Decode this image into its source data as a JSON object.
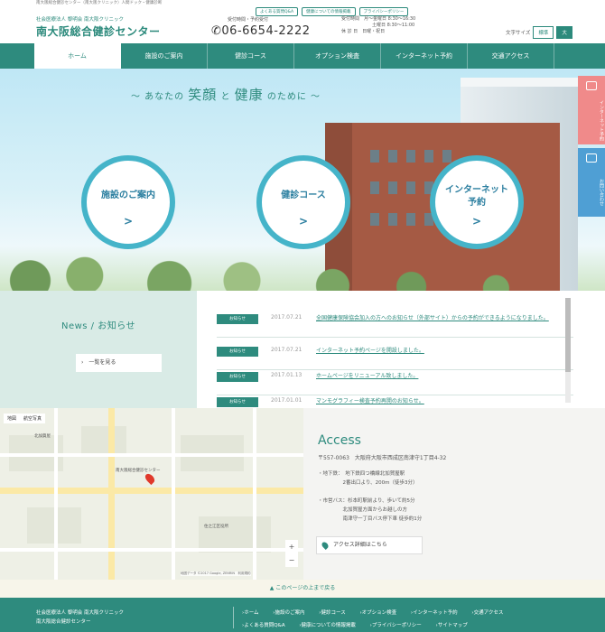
{
  "topstrip": {
    "text": "南大阪総合健診センター（南大阪クリニック）人間ドック・健康診断"
  },
  "header": {
    "corp_sub": "社会医療法人 黎明会 南大阪クリニック",
    "corp_title": "南大阪総合健診センター",
    "tel": "06-6654-2222",
    "hours_label": "受付時間・予約受付",
    "hours": [
      "受付時間　月～金曜日 8:30～16:30",
      "土曜日 8:30～11:00",
      "休 診 日　日曜・祝日"
    ],
    "toplinks": [
      "よくある質問Q&A",
      "健康についての情報掲載",
      "プライバシーポリシー"
    ],
    "font_size_label": "文字サイズ",
    "font_std": "標準",
    "font_big": "大"
  },
  "nav": {
    "items": [
      "ホーム",
      "施設のご案内",
      "健診コース",
      "オプション検査",
      "インターネット予約",
      "交通アクセス"
    ]
  },
  "hero": {
    "title_pre": "〜 あなたの ",
    "title_em1": "笑顔",
    "title_mid": " と ",
    "title_em2": "健康",
    "title_post": " のために 〜",
    "circles": [
      {
        "label": "施設のご案内",
        "chev": ">"
      },
      {
        "label": "健診コース",
        "chev": ">"
      },
      {
        "label": "インターネット予約",
        "chev": ">"
      }
    ],
    "sidetab_1": "インターネット予約",
    "sidetab_2": "お問い合わせ"
  },
  "news": {
    "title": "News / お知らせ",
    "button": "一覧を見る",
    "items": [
      {
        "badge": "お知らせ",
        "date": "2017.07.21",
        "text": "全国健康保険協会加入の方へのお知らせ（外部サイト）からの予約ができるようになりました。"
      },
      {
        "badge": "お知らせ",
        "date": "2017.07.21",
        "text": "インターネット予約ページを開設しました。"
      },
      {
        "badge": "お知らせ",
        "date": "2017.01.13",
        "text": "ホームページをリニューアル致しました。"
      },
      {
        "badge": "お知らせ",
        "date": "2017.01.01",
        "text": "マンモグラフィー検査予約再開のお知らせ。"
      }
    ]
  },
  "map": {
    "type_map": "地図",
    "type_sat": "航空写真",
    "labels": [
      "北加賀屋",
      "南大阪総合健診センター",
      "住之江区役所"
    ],
    "copy": "地図データ ©2017 Google, ZENRIN　利用規約",
    "zoom_in": "+",
    "zoom_out": "−"
  },
  "access": {
    "title": "Access",
    "addr": "〒557-0063　大阪府大阪市西成区南津守1丁目4-32",
    "lines": [
      "・地下鉄：　地下鉄四つ橋線北加賀屋駅",
      "　　　　　2番出口より、200m（徒歩3分）",
      "・市営バス：杉本町駅前より、歩いて約5分",
      "　　　　　北加賀屋方面からお越しの方",
      "　　　　　南津守一丁目バス停下車 徒歩約1分"
    ],
    "button": "アクセス詳細はこちら"
  },
  "pagetop": {
    "text": "このページの上まで戻る"
  },
  "footer": {
    "org_1": "社会医療法人 黎明会 南大阪クリニック",
    "org_2": "南大阪総合健診センター",
    "links": [
      "ホーム",
      "施設のご案内",
      "健診コース",
      "オプション検査",
      "インターネット予約",
      "交通アクセス",
      "よくある質問Q&A",
      "健康についての情報掲載",
      "プライバシーポリシー",
      "サイトマップ"
    ]
  },
  "colors": {
    "brand": "#2e8b7e",
    "accent_circle": "#45b4c9",
    "tab_pink": "#f08a8a",
    "tab_blue": "#4f9fd4"
  }
}
